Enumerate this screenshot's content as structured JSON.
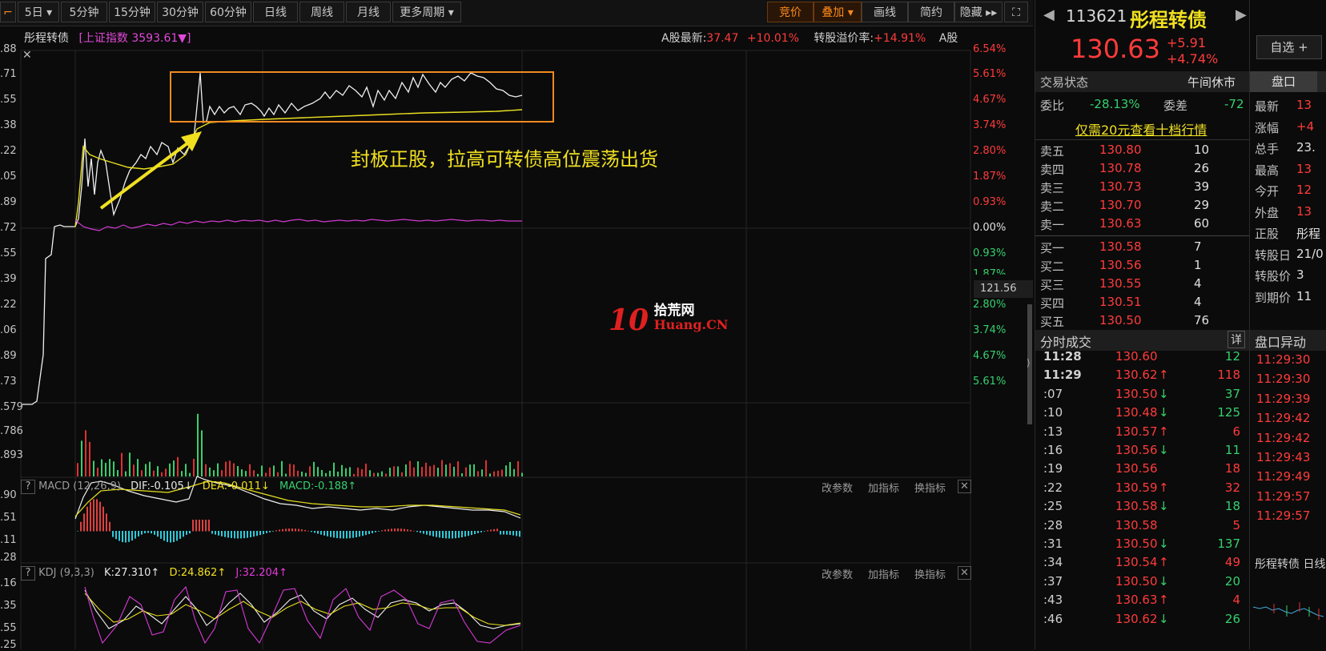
{
  "toolbar": {
    "periods": [
      "5日",
      "5分钟",
      "15分钟",
      "30分钟",
      "60分钟",
      "日线",
      "周线",
      "月线",
      "更多周期"
    ],
    "right_buttons": [
      "竞价",
      "叠加",
      "画线",
      "简约",
      "隐藏"
    ]
  },
  "chart_header": {
    "name": "彤程转债",
    "index_label": "[上证指数 3593.61▼]",
    "a_share_label": "A股最新:",
    "a_share_price": "37.47",
    "a_share_pct": "+10.01%",
    "premium_label": "转股溢价率:",
    "premium_value": "+14.91%",
    "tail": "A股"
  },
  "left_axis": [
    ".88",
    ".71",
    ".55",
    ".38",
    ".22",
    ".05",
    ".89",
    ".72",
    ".55",
    ".39",
    ".22",
    ".06",
    ".89",
    ".73",
    ".579",
    ".786",
    ".893"
  ],
  "right_axis": [
    {
      "text": "6.54%",
      "color": "red"
    },
    {
      "text": "5.61%",
      "color": "red"
    },
    {
      "text": "4.67%",
      "color": "red"
    },
    {
      "text": "3.74%",
      "color": "red"
    },
    {
      "text": "2.80%",
      "color": "red"
    },
    {
      "text": "1.87%",
      "color": "red"
    },
    {
      "text": "0.93%",
      "color": "red"
    },
    {
      "text": "0.00%",
      "color": "white"
    },
    {
      "text": "0.93%",
      "color": "green"
    },
    {
      "text": "1.87%",
      "color": "green"
    },
    {
      "text": "2.80%",
      "color": "green"
    },
    {
      "text": "3.74%",
      "color": "green"
    },
    {
      "text": "4.67%",
      "color": "green"
    },
    {
      "text": "5.61%",
      "color": "green"
    }
  ],
  "crosshair_value": "121.56",
  "annotation": "封板正股，拉高可转债高位震荡出货",
  "watermark": {
    "brand": "10",
    "cn": "拾荒网",
    "en": "Huang.CN"
  },
  "macd": {
    "label": "MACD (12,26,9)",
    "dif": "DIF:-0.105↓",
    "dea": "DEA:-0.011↓",
    "macd": "MACD:-0.188↑",
    "axis": [
      ".90",
      ".51",
      ".11",
      ".28"
    ]
  },
  "kdj": {
    "label": "KDJ (9,3,3)",
    "k": "K:27.310↑",
    "d": "D:24.862↑",
    "j": "J:32.204↑",
    "axis": [
      ".16",
      ".35",
      ".55",
      ".25"
    ]
  },
  "indicator_buttons": [
    "改参数",
    "加指标",
    "换指标"
  ],
  "quote": {
    "code": "113621",
    "name": "彤程转债",
    "price": "130.63",
    "change": "+5.91",
    "change_pct": "+4.74%",
    "watch_button": "自选 +",
    "tab": "盘口"
  },
  "status": {
    "label": "交易状态",
    "value": "午间休市"
  },
  "ratio": {
    "label1": "委比",
    "value1": "-28.13%",
    "label2": "委差",
    "value2": "-72"
  },
  "promo": "仅需20元查看十档行情",
  "asks": [
    {
      "label": "卖五",
      "price": "130.80",
      "vol": "10"
    },
    {
      "label": "卖四",
      "price": "130.78",
      "vol": "26"
    },
    {
      "label": "卖三",
      "price": "130.73",
      "vol": "39"
    },
    {
      "label": "卖二",
      "price": "130.70",
      "vol": "29"
    },
    {
      "label": "卖一",
      "price": "130.63",
      "vol": "60"
    }
  ],
  "bids": [
    {
      "label": "买一",
      "price": "130.58",
      "vol": "7"
    },
    {
      "label": "买二",
      "price": "130.56",
      "vol": "1"
    },
    {
      "label": "买三",
      "price": "130.55",
      "vol": "4"
    },
    {
      "label": "买四",
      "price": "130.51",
      "vol": "4"
    },
    {
      "label": "买五",
      "price": "130.50",
      "vol": "76"
    }
  ],
  "trades_title": "分时成交",
  "trades_detail": "详",
  "trades": [
    {
      "t": "11:28",
      "p": "130.60",
      "arrow": "",
      "v": "12",
      "vc": "green",
      "bold": true
    },
    {
      "t": "11:29",
      "p": "130.62",
      "arrow": "↑",
      "v": "118",
      "vc": "red",
      "bold": true
    },
    {
      "t": ":07",
      "p": "130.50",
      "arrow": "↓",
      "v": "37",
      "vc": "green"
    },
    {
      "t": ":10",
      "p": "130.48",
      "arrow": "↓",
      "v": "125",
      "vc": "green"
    },
    {
      "t": ":13",
      "p": "130.57",
      "arrow": "↑",
      "v": "6",
      "vc": "red"
    },
    {
      "t": ":16",
      "p": "130.56",
      "arrow": "↓",
      "v": "11",
      "vc": "green"
    },
    {
      "t": ":19",
      "p": "130.56",
      "arrow": "",
      "v": "18",
      "vc": "red"
    },
    {
      "t": ":22",
      "p": "130.59",
      "arrow": "↑",
      "v": "32",
      "vc": "red"
    },
    {
      "t": ":25",
      "p": "130.58",
      "arrow": "↓",
      "v": "18",
      "vc": "green"
    },
    {
      "t": ":28",
      "p": "130.58",
      "arrow": "",
      "v": "5",
      "vc": "red"
    },
    {
      "t": ":31",
      "p": "130.50",
      "arrow": "↓",
      "v": "137",
      "vc": "green"
    },
    {
      "t": ":34",
      "p": "130.54",
      "arrow": "↑",
      "v": "49",
      "vc": "red"
    },
    {
      "t": ":37",
      "p": "130.50",
      "arrow": "↓",
      "v": "20",
      "vc": "green"
    },
    {
      "t": ":43",
      "p": "130.63",
      "arrow": "↑",
      "v": "4",
      "vc": "red"
    },
    {
      "t": ":46",
      "p": "130.62",
      "arrow": "↓",
      "v": "26",
      "vc": "green"
    }
  ],
  "side_stats": [
    {
      "label": "最新",
      "value": "13"
    },
    {
      "label": "涨幅",
      "value": "+4"
    },
    {
      "label": "总手",
      "value": "23."
    },
    {
      "label": "最高",
      "value": "13"
    },
    {
      "label": "今开",
      "value": "12"
    },
    {
      "label": "外盘",
      "value": "13"
    },
    {
      "label": "正股",
      "value": "彤程"
    },
    {
      "label": "转股日",
      "value": "21/0"
    },
    {
      "label": "转股价",
      "value": "3"
    },
    {
      "label": "到期价",
      "value": "11"
    }
  ],
  "anomaly_title": "盘口异动",
  "anomaly_times": [
    "11:29:30",
    "11:29:30",
    "11:29:39",
    "11:29:42",
    "11:29:42",
    "11:29:43",
    "11:29:49",
    "11:29:57",
    "11:29:57"
  ],
  "mini_chart_title": "彤程转债 日线"
}
